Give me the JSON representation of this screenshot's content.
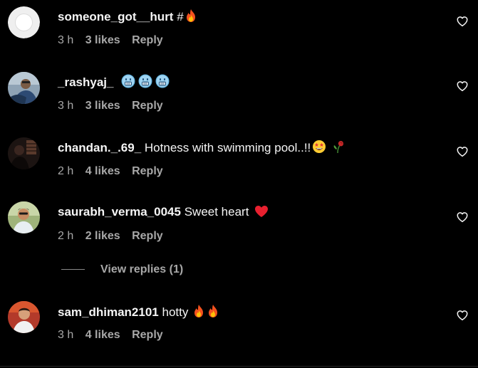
{
  "colors": {
    "background": "#000000",
    "text_primary": "#f5f5f5",
    "text_secondary": "#a8a8a8"
  },
  "comments": [
    {
      "username": "someone_got__hurt",
      "text": "#",
      "emojis": [
        "fire"
      ],
      "time": "3 h",
      "likes": "3 likes",
      "reply": "Reply",
      "avatar": "default-avatar"
    },
    {
      "username": "_rashyaj_",
      "text": "",
      "emojis": [
        "cold-face",
        "cold-face",
        "cold-face"
      ],
      "time": "3 h",
      "likes": "3 likes",
      "reply": "Reply",
      "avatar": "profile-photo"
    },
    {
      "username": "chandan._.69_",
      "text": "Hotness with swimming pool..!!",
      "emojis": [
        "star-struck",
        "wilted-rose"
      ],
      "time": "2 h",
      "likes": "4 likes",
      "reply": "Reply",
      "avatar": "profile-photo"
    },
    {
      "username": "saurabh_verma_0045",
      "text": "Sweet heart",
      "emojis": [
        "red-heart"
      ],
      "time": "2 h",
      "likes": "2 likes",
      "reply": "Reply",
      "avatar": "profile-photo",
      "view_replies": "View replies (1)"
    },
    {
      "username": "sam_dhiman2101",
      "text": "hotty",
      "emojis": [
        "fire",
        "fire"
      ],
      "time": "3 h",
      "likes": "4 likes",
      "reply": "Reply",
      "avatar": "profile-photo"
    }
  ]
}
